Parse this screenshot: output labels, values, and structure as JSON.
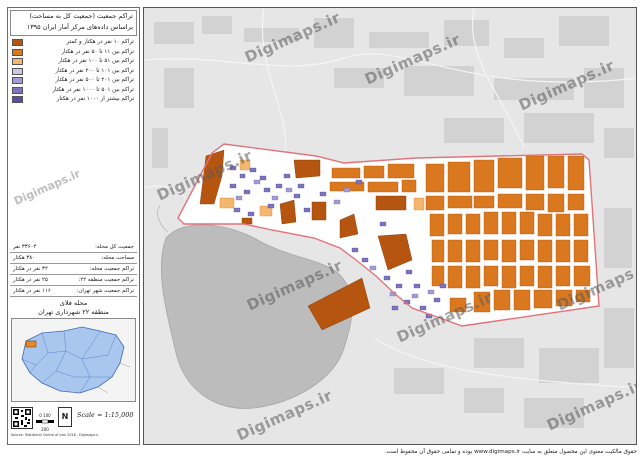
{
  "title": {
    "line1": "تراکم جمعیت (جمعیت کل به مساحت)",
    "line2": "براساس داده‌های مرکز آمار ایران ۱۳۹۵"
  },
  "legend": [
    {
      "label": "تراکم ۱۰ نفر در هکتار و کمتر",
      "color": "#b5550f"
    },
    {
      "label": "تراکم بین ۱۱ تا ۵۰ نفر در هکتار",
      "color": "#d9781f"
    },
    {
      "label": "تراکم بین ۵۱ تا ۱۰۰ نفر در هکتار",
      "color": "#f5b76e"
    },
    {
      "label": "تراکم بین ۱۰۱ تا ۲۰۰ نفر در هکتار",
      "color": "#cfc6e6"
    },
    {
      "label": "تراکم بین ۲۰۱ تا ۵۰۰ نفر در هکتار",
      "color": "#a39bd2"
    },
    {
      "label": "تراکم بین ۵۰۱ تا ۱۰۰۰ نفر در هکتار",
      "color": "#7d74bd"
    },
    {
      "label": "تراکم بیشتر از ۱۰۰۰ نفر در هکتار",
      "color": "#5a4fa8"
    }
  ],
  "stats": [
    {
      "key": "جمعیت کل محله:",
      "value": "۳۳۶۰۴ نفر"
    },
    {
      "key": "مساحت محله:",
      "value": "۳۸۰ هکتار"
    },
    {
      "key": "تراکم جمعیت محله:",
      "value": "۳۲ نفر در هکتار"
    },
    {
      "key": "تراکم جمعیت منطقه ۲۲:",
      "value": "۲۵ نفر در هکتار"
    },
    {
      "key": "تراکم جمعیت شهر تهران:",
      "value": "۱۱۶ نفر در هکتار"
    }
  ],
  "district": {
    "line1": "محله فلای",
    "line2": "منطقه ۲۲ شهرداری تهران"
  },
  "scale_text": "Scale = 1:15,000",
  "scalebar_label": "0  100  200",
  "north_label": "N",
  "credit_small": "Source: Statistical Centre of Iran 2016 - Digimaps.ir",
  "watermark": "Digimaps.ir",
  "copyright": "حقوق مالکیت معنوی این محصول متعلق به سایت www.digimaps.ir بوده و تمامی حقوق آن محفوظ است.",
  "colors": {
    "outline": "#e2737a",
    "map_bg": "#e6e6e6",
    "lake": "#bcbcbc",
    "block_white": "#ffffff"
  }
}
